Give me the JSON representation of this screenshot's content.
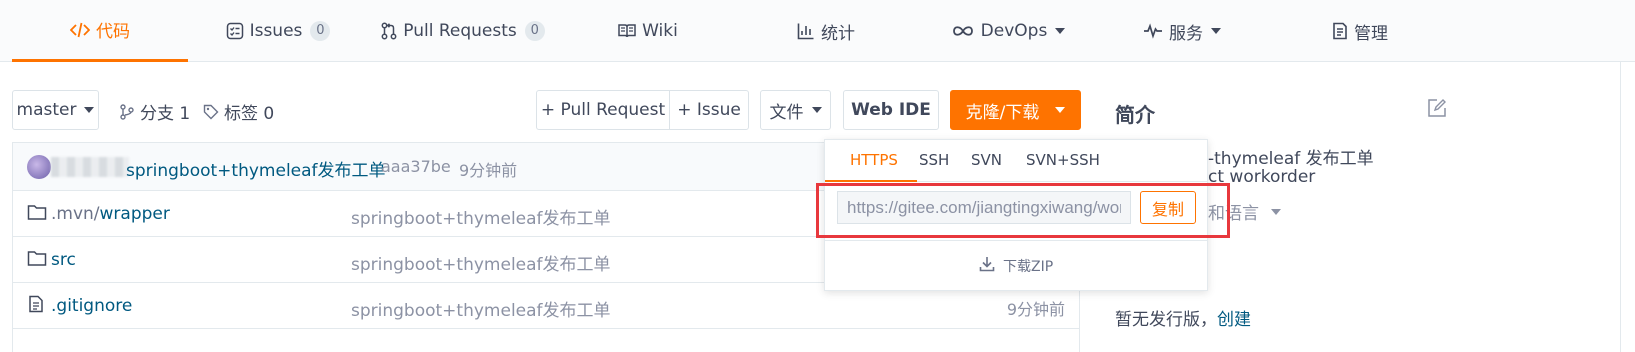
{
  "tabs": [
    {
      "label": "代码",
      "icon": "code-icon",
      "active": true
    },
    {
      "label": "Issues",
      "count": "0",
      "icon": "issues-icon"
    },
    {
      "label": "Pull Requests",
      "count": "0",
      "icon": "pull-request-icon"
    },
    {
      "label": "Wiki",
      "icon": "book-icon"
    },
    {
      "label": "统计",
      "icon": "bar-chart-icon"
    },
    {
      "label": "DevOps",
      "icon": "infinity-icon",
      "dropdown": true
    },
    {
      "label": "服务",
      "icon": "pulse-icon",
      "dropdown": true
    },
    {
      "label": "管理",
      "icon": "settings-doc-icon"
    }
  ],
  "toolbar": {
    "branch": "master",
    "branches_label": "分支 1",
    "tags_label": "标签 0",
    "pull_request": "+ Pull Request",
    "issue": "+ Issue",
    "file": "文件",
    "web_ide": "Web IDE",
    "clone": "克隆/下载"
  },
  "commit": {
    "message": "springboot+thymeleaf发布工单",
    "hash": "aaa37be",
    "time": "9分钟前"
  },
  "files": [
    {
      "prefix": ".mvn/",
      "name": "wrapper",
      "type": "folder",
      "message": "springboot+thymeleaf发布工单",
      "time": ""
    },
    {
      "prefix": "",
      "name": "src",
      "type": "folder",
      "message": "springboot+thymeleaf发布工单",
      "time": ""
    },
    {
      "prefix": "",
      "name": ".gitignore",
      "type": "file",
      "message": "springboot+thymeleaf发布工单",
      "time": "9分钟前"
    }
  ],
  "sidebar": {
    "title": "简介",
    "desc_line1": "-thymeleaf 发布工单",
    "desc_line2": "ct workorder",
    "lang_line": "和语言",
    "release_text": "暂无发行版，",
    "release_link": "创建"
  },
  "clone_dropdown": {
    "tabs": [
      "HTTPS",
      "SSH",
      "SVN",
      "SVN+SSH"
    ],
    "active_tab": "HTTPS",
    "url": "https://gitee.com/jiangtingxiwang/workorder.git",
    "copy": "复制",
    "download_zip": "下载ZIP"
  },
  "colors": {
    "accent": "#fe7300",
    "link": "#005980",
    "highlight": "#e8383d"
  }
}
